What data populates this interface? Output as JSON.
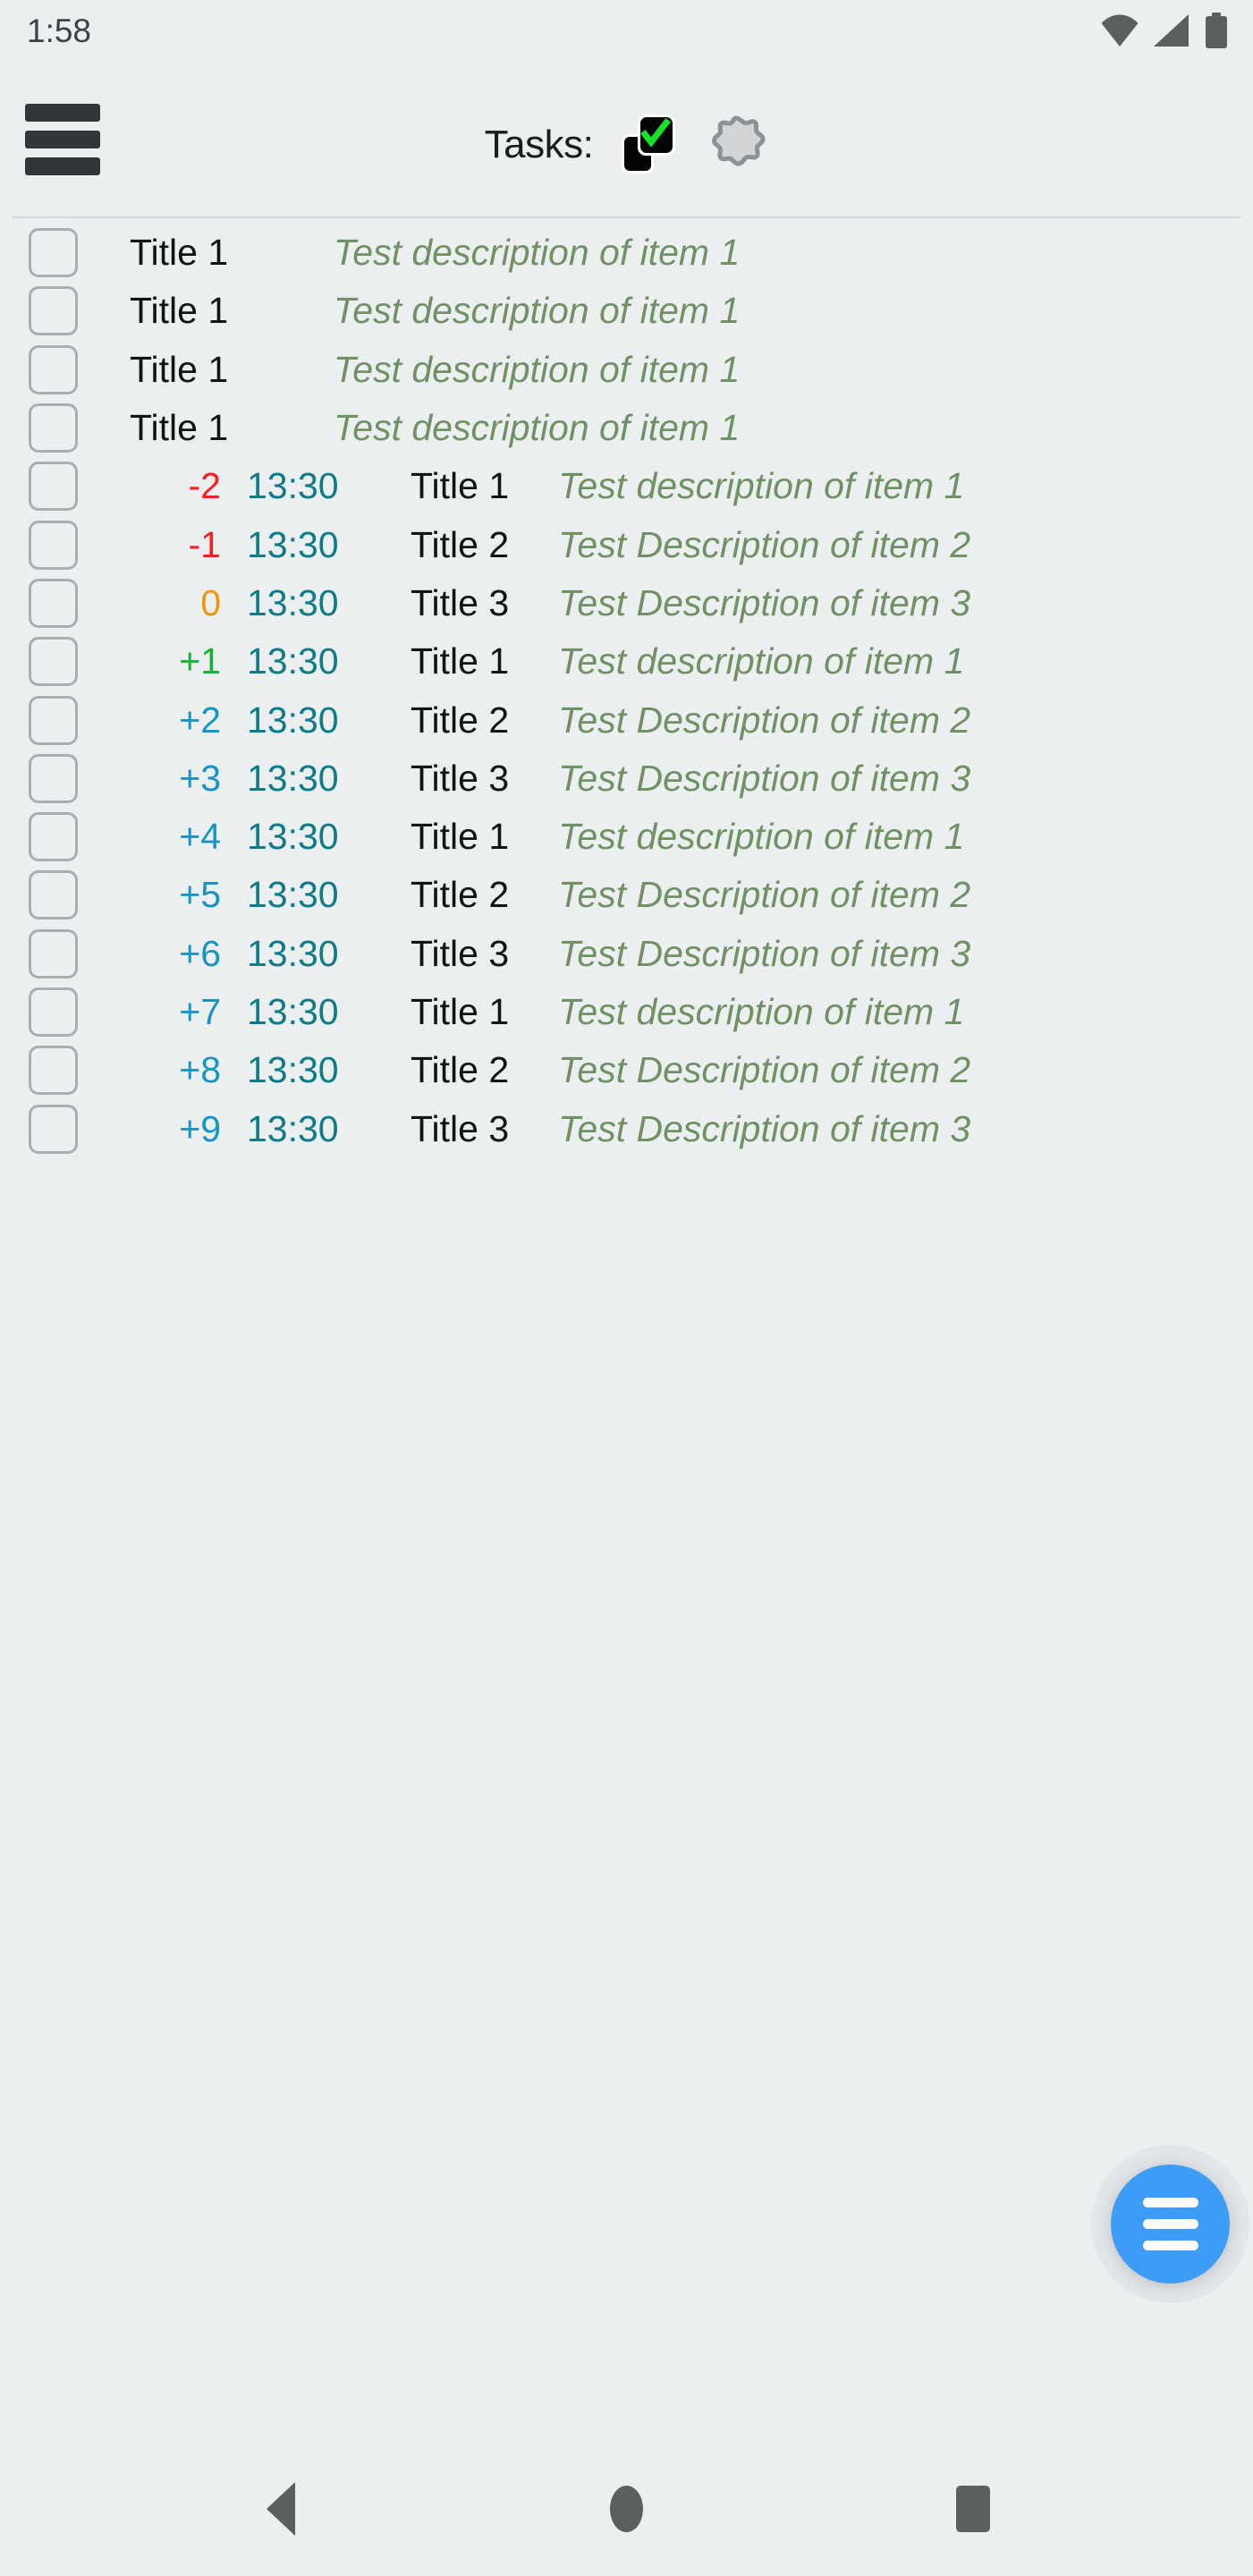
{
  "status_bar": {
    "clock": "1:58",
    "icons": [
      "wifi-icon",
      "signal-icon",
      "battery-icon"
    ]
  },
  "app_bar": {
    "menu_icon": "hamburger-menu-icon",
    "title": "Tasks:",
    "actions": [
      {
        "icon": "checkbox-check-icon",
        "label": "Toggle completed"
      },
      {
        "icon": "gear-flower-icon",
        "label": "Settings"
      }
    ]
  },
  "colors": {
    "background": "#eceff0",
    "title_text": "#111314",
    "description_text": "#6f9164",
    "time_text": "#0d7b88",
    "offset_negative": "#f71f1f",
    "offset_zero": "#ef9409",
    "offset_positive_near": "#10b238",
    "offset_positive_far": "#1794c6",
    "accent_fab": "#3d9cf5",
    "checkbox_border": "#a9aeb0",
    "divider": "#d2d7d9"
  },
  "tasks": [
    {
      "checked": false,
      "offset": "",
      "offset_color": "",
      "time": "",
      "title": "Title 1",
      "description": "Test description of item 1",
      "simple": true
    },
    {
      "checked": false,
      "offset": "",
      "offset_color": "",
      "time": "",
      "title": "Title 1",
      "description": "Test description of item 1",
      "simple": true
    },
    {
      "checked": false,
      "offset": "",
      "offset_color": "",
      "time": "",
      "title": "Title 1",
      "description": "Test description of item 1",
      "simple": true
    },
    {
      "checked": false,
      "offset": "",
      "offset_color": "",
      "time": "",
      "title": "Title 1",
      "description": "Test description of item 1",
      "simple": true
    },
    {
      "checked": false,
      "offset": "-2",
      "offset_color": "#f71f1f",
      "time": "13:30",
      "title": "Title 1",
      "description": "Test description of item 1",
      "simple": false
    },
    {
      "checked": false,
      "offset": "-1",
      "offset_color": "#f71f1f",
      "time": "13:30",
      "title": "Title 2",
      "description": "Test Description of item 2",
      "simple": false
    },
    {
      "checked": false,
      "offset": "0",
      "offset_color": "#ef9409",
      "time": "13:30",
      "title": "Title 3",
      "description": "Test Description of item 3",
      "simple": false
    },
    {
      "checked": false,
      "offset": "+1",
      "offset_color": "#10b238",
      "time": "13:30",
      "title": "Title 1",
      "description": "Test description of item 1",
      "simple": false
    },
    {
      "checked": false,
      "offset": "+2",
      "offset_color": "#1794c6",
      "time": "13:30",
      "title": "Title 2",
      "description": "Test Description of item 2",
      "simple": false
    },
    {
      "checked": false,
      "offset": "+3",
      "offset_color": "#1794c6",
      "time": "13:30",
      "title": "Title 3",
      "description": "Test Description of item 3",
      "simple": false
    },
    {
      "checked": false,
      "offset": "+4",
      "offset_color": "#1794c6",
      "time": "13:30",
      "title": "Title 1",
      "description": "Test description of item 1",
      "simple": false
    },
    {
      "checked": false,
      "offset": "+5",
      "offset_color": "#1794c6",
      "time": "13:30",
      "title": "Title 2",
      "description": "Test Description of item 2",
      "simple": false
    },
    {
      "checked": false,
      "offset": "+6",
      "offset_color": "#1794c6",
      "time": "13:30",
      "title": "Title 3",
      "description": "Test Description of item 3",
      "simple": false
    },
    {
      "checked": false,
      "offset": "+7",
      "offset_color": "#1794c6",
      "time": "13:30",
      "title": "Title 1",
      "description": "Test description of item 1",
      "simple": false
    },
    {
      "checked": false,
      "offset": "+8",
      "offset_color": "#1794c6",
      "time": "13:30",
      "title": "Title 2",
      "description": "Test Description of item 2",
      "simple": false
    },
    {
      "checked": false,
      "offset": "+9",
      "offset_color": "#1794c6",
      "time": "13:30",
      "title": "Title 3",
      "description": "Test Description of item 3",
      "simple": false
    }
  ],
  "fab": {
    "icon": "list-menu-icon",
    "label": "Add task"
  },
  "nav_bar": {
    "buttons": [
      {
        "icon": "back-triangle-icon",
        "label": "Back"
      },
      {
        "icon": "home-circle-icon",
        "label": "Home"
      },
      {
        "icon": "recents-square-icon",
        "label": "Recents"
      }
    ]
  }
}
